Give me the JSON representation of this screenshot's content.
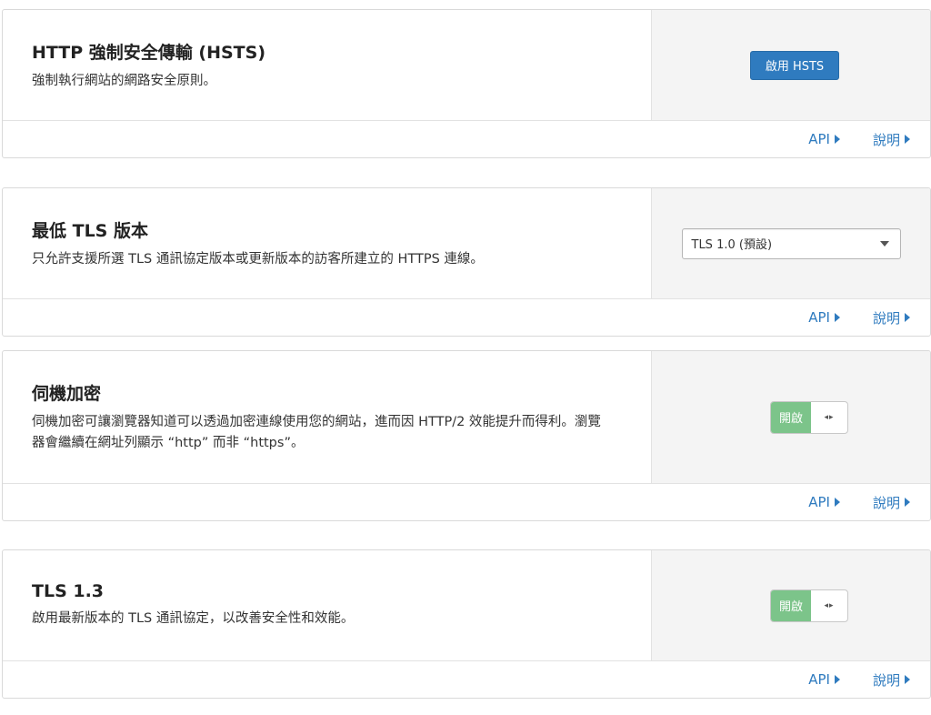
{
  "cards": [
    {
      "title": "HTTP 強制安全傳輸 (HSTS)",
      "description": "強制執行網站的網路安全原則。",
      "control": {
        "type": "button",
        "label": "啟用 HSTS"
      },
      "footer": {
        "api_label": "API",
        "help_label": "說明"
      }
    },
    {
      "title": "最低 TLS 版本",
      "description": "只允許支援所選 TLS 通訊協定版本或更新版本的訪客所建立的 HTTPS 連線。",
      "control": {
        "type": "select",
        "value": "TLS 1.0 (預設)"
      },
      "footer": {
        "api_label": "API",
        "help_label": "說明"
      }
    },
    {
      "title": "伺機加密",
      "description": "伺機加密可讓瀏覽器知道可以透過加密連線使用您的網站，進而因 HTTP/2 效能提升而得利。瀏覽器會繼續在網址列顯示 “http” 而非 “https”。",
      "control": {
        "type": "toggle",
        "state_label": "開啟",
        "knob_glyph": "◂▸"
      },
      "footer": {
        "api_label": "API",
        "help_label": "說明"
      }
    },
    {
      "title": "TLS 1.3",
      "description": "啟用最新版本的 TLS 通訊協定，以改善安全性和效能。",
      "control": {
        "type": "toggle",
        "state_label": "開啟",
        "knob_glyph": "◂▸"
      },
      "footer": {
        "api_label": "API",
        "help_label": "說明"
      }
    }
  ],
  "colors": {
    "accent": "#2f7bbf",
    "toggle_on": "#7cc48a"
  }
}
